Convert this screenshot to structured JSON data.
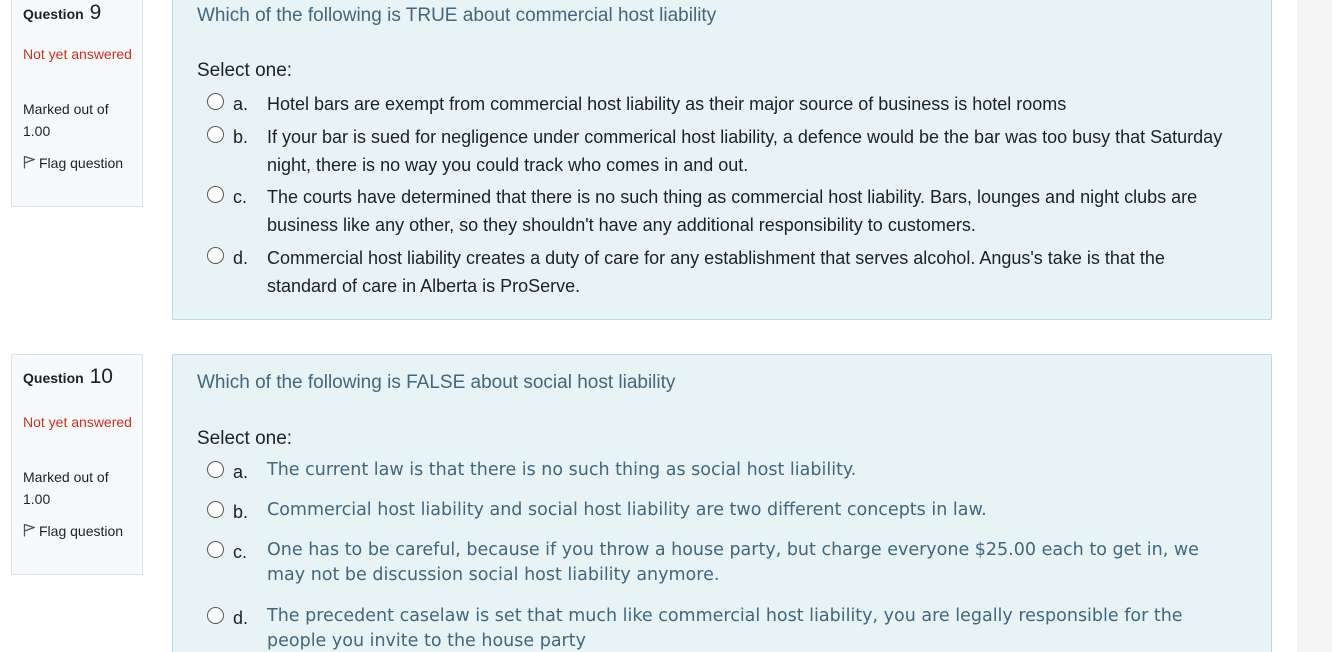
{
  "questions": [
    {
      "label": "Question",
      "number": "9",
      "state": "Not yet answered",
      "marked": "Marked out of 1.00",
      "flag": "Flag question",
      "text": "Which of the following is TRUE about commercial host liability",
      "prompt": "Select one:",
      "options": [
        {
          "letter": "a.",
          "text": "Hotel bars are exempt from commercial host liability as their major source of business is hotel rooms"
        },
        {
          "letter": "b.",
          "text": "If your bar is sued for negligence under commerical host liability, a defence would be the bar was too busy that Saturday night, there is no way you could track who comes in and out."
        },
        {
          "letter": "c.",
          "text": "The courts have determined that there is no such thing as commercial host liability.  Bars, lounges and night clubs are business like any other, so they shouldn't have any additional responsibility to customers."
        },
        {
          "letter": "d.",
          "text": "Commercial host liability creates a duty of care for any establishment that serves alcohol.  Angus's take is that  the standard of care in Alberta is ProServe."
        }
      ]
    },
    {
      "label": "Question",
      "number": "10",
      "state": "Not yet answered",
      "marked": "Marked out of 1.00",
      "flag": "Flag question",
      "text": "Which of the following is FALSE about social host liability",
      "prompt": "Select one:",
      "options": [
        {
          "letter": "a.",
          "text": "The current law is that there is no such thing as social host liability."
        },
        {
          "letter": "b.",
          "text": "Commercial host liability and social host liability are two different concepts in law."
        },
        {
          "letter": "c.",
          "text": "One has to be careful, because if you throw a house party, but charge everyone $25.00 each to get in, we may not be discussion social host liability anymore."
        },
        {
          "letter": "d.",
          "text": "The precedent caselaw is set that much like commercial host liability, you are legally responsible for the people you invite to the house party"
        }
      ]
    }
  ]
}
